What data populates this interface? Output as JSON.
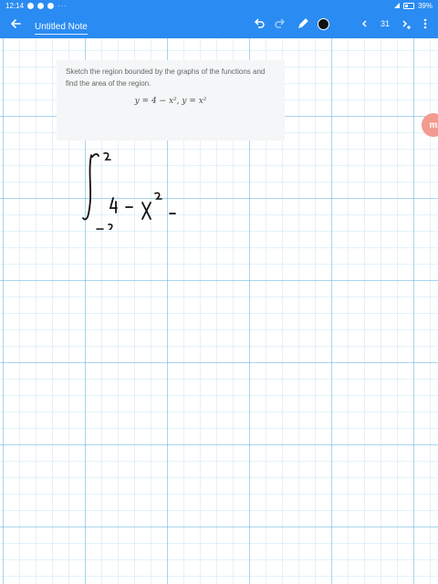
{
  "status_bar": {
    "time": "12:14",
    "dots": "···",
    "battery": "39%"
  },
  "app_bar": {
    "title": "Untitled Note",
    "page_number": "31",
    "pen_color": "#111111"
  },
  "problem": {
    "text": "Sketch the region bounded by the graphs of the functions and find the area of the region.",
    "equation": "y = 4 − x², y = x²"
  },
  "side_logo": {
    "label": "m"
  },
  "colors": {
    "primary": "#2a8bf2",
    "grid": "#5aaadc",
    "card_bg": "#f5f6f7"
  }
}
